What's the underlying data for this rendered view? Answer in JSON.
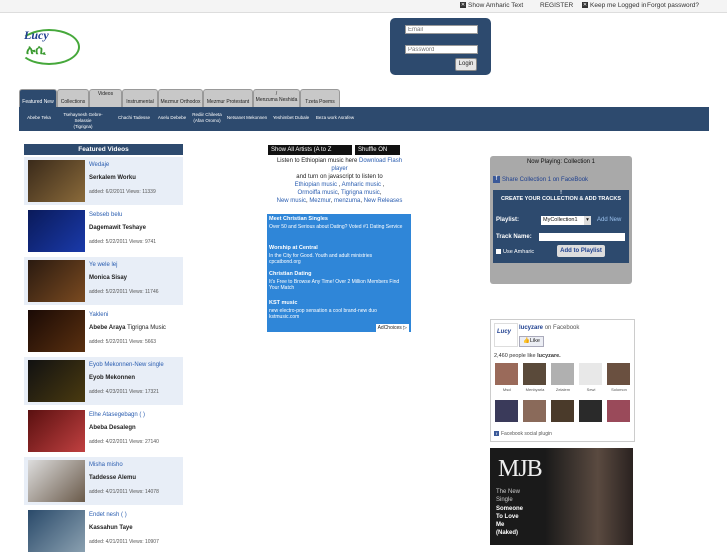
{
  "topbar": {
    "show_amharic": "Show Amharic Text",
    "register": "REGISTER",
    "keep_logged_in": "Keep me Logged in",
    "forgot_password": "Forgot password?"
  },
  "logo": {
    "word": "Lucy",
    "script": "ሉሲ"
  },
  "login": {
    "email_placeholder": "Email",
    "password_placeholder": "Password",
    "button": "Login"
  },
  "tabs": [
    {
      "label": "Featured New",
      "sub": ""
    },
    {
      "label": "Collections",
      "sub": ""
    },
    {
      "label": "Videos",
      "sub": ""
    },
    {
      "label": "Instrumental",
      "sub": ""
    },
    {
      "label": "Mezmur Orthodox",
      "sub": ""
    },
    {
      "label": "Mezmur Protestant",
      "sub": ""
    },
    {
      "label": "Menzuma Neshida",
      "sub": "/"
    },
    {
      "label": "Tzeta Poems",
      "sub": ""
    }
  ],
  "subnav": [
    {
      "line1": "Abebe Teka",
      "line2": ""
    },
    {
      "line1": "Tsehaynesh Gebre-Selassie",
      "line2": "(Tigrigna)"
    },
    {
      "line1": "Chachi Tadesse",
      "line2": ""
    },
    {
      "line1": "Aselu Debebe",
      "line2": ""
    },
    {
      "line1": "Rediir Chileeta",
      "line2": "(Afan Oromo)"
    },
    {
      "line1": "Netsanet Mekonnen",
      "line2": ""
    },
    {
      "line1": "Yeshimbet Dubale",
      "line2": ""
    },
    {
      "line1": "Beza work Asrafew",
      "line2": ""
    }
  ],
  "featured": {
    "heading": "Featured Videos",
    "items": [
      {
        "title": "Wedaje",
        "artist": "Serkalem Worku",
        "meta": "added: 6/2/2011 Views: 11339"
      },
      {
        "title": "Sebseb belu",
        "artist": "Dagemawit Teshaye",
        "meta": "added: 5/22/2011 Views: 9741"
      },
      {
        "title": "Ye wele lej",
        "artist": "Monica Sisay",
        "meta": "added: 5/22/2011 Views: 11746"
      },
      {
        "title": "Yakleni",
        "artist": "Abebe Araya",
        "artist_extra": "Tigrigna Music",
        "meta": "added: 5/22/2011 Views: 5663"
      },
      {
        "title": "Eyob Mekonnen-New single",
        "artist": "Eyob Mekonnen",
        "meta": "added: 4/23/2011 Views: 17321"
      },
      {
        "title": "Elhe Atasegebagn (          )",
        "artist": "Abeba Desalegn",
        "meta": "added: 4/22/2011 Views: 27140"
      },
      {
        "title": "Misha misho",
        "artist": "Taddesse Alemu",
        "meta": "added: 4/21/2011 Views: 14078"
      },
      {
        "title": "Endet nesh (          )",
        "artist": "Kassahun Taye",
        "meta": "added: 4/21/2011 Views: 10907"
      }
    ]
  },
  "center": {
    "show_all": "Show All Artists (A to Z",
    "shuffle": "Shuffle ON",
    "intro": "Listen to Ethiopian music here",
    "download_flash": "Download Flash player",
    "and_turn_on": "and turn on javascript to listen to",
    "ethiopian_music": "Ethiopian music",
    "amharic_music": "Amharic music",
    "oromiffa_music": "Ormoiffa music",
    "tigrigna_music": "Tigrigna music",
    "new_music": "New music",
    "mezmur": "Mezmur",
    "menzuma": "menzuma",
    "new_releases": "New Releases"
  },
  "ads": {
    "items": [
      {
        "title": "Meet Christian Singles",
        "text": "Over 50 and Serious about Dating? Voted #1 Dating Service"
      },
      {
        "title": "Worship at Central",
        "text": "In the City for Good. Youth and adult ministries cpcatbond.org"
      },
      {
        "title": "Christian Dating",
        "text": "It's Free to Browse Any Time! Over 2 Million Members Find Your Match"
      },
      {
        "title": "KST music",
        "text": "new electro-pop sensation a cool brand-new duo kstmusic.com"
      }
    ],
    "adchoices": "AdChoices ▷"
  },
  "player": {
    "now_playing": "Now Playing: Collection 1",
    "share": "Share Collection 1 on FaceBook",
    "create_head_top": "!",
    "create_head": "CREATE YOUR COLLECTION & ADD TRACKS",
    "playlist_label": "Playlist:",
    "playlist_value": "MyCollection1",
    "add_new": "Add New",
    "track_name_label": "Track Name:",
    "use_amharic": "Use Amharic",
    "add_to_playlist": "Add to Playlist"
  },
  "fb": {
    "page_name": "lucyzare",
    "on_facebook": "on Facebook",
    "like": "Like",
    "count": "2,460 people like",
    "count_name": "lucyzare.",
    "fans": [
      {
        "name": "Mscl"
      },
      {
        "name": "Menbyarla"
      },
      {
        "name": "Zelalem"
      },
      {
        "name": "Sewi"
      },
      {
        "name": "Solomon"
      },
      {
        "name": ""
      },
      {
        "name": ""
      },
      {
        "name": ""
      },
      {
        "name": ""
      },
      {
        "name": ""
      }
    ],
    "plugin": "Facebook social plugin"
  },
  "ad_image": {
    "logo": "MJB",
    "line1": "The New",
    "line2": "Single",
    "line3": "Someone",
    "line4": "To Love",
    "line5": "Me",
    "line6": "(Naked)"
  }
}
